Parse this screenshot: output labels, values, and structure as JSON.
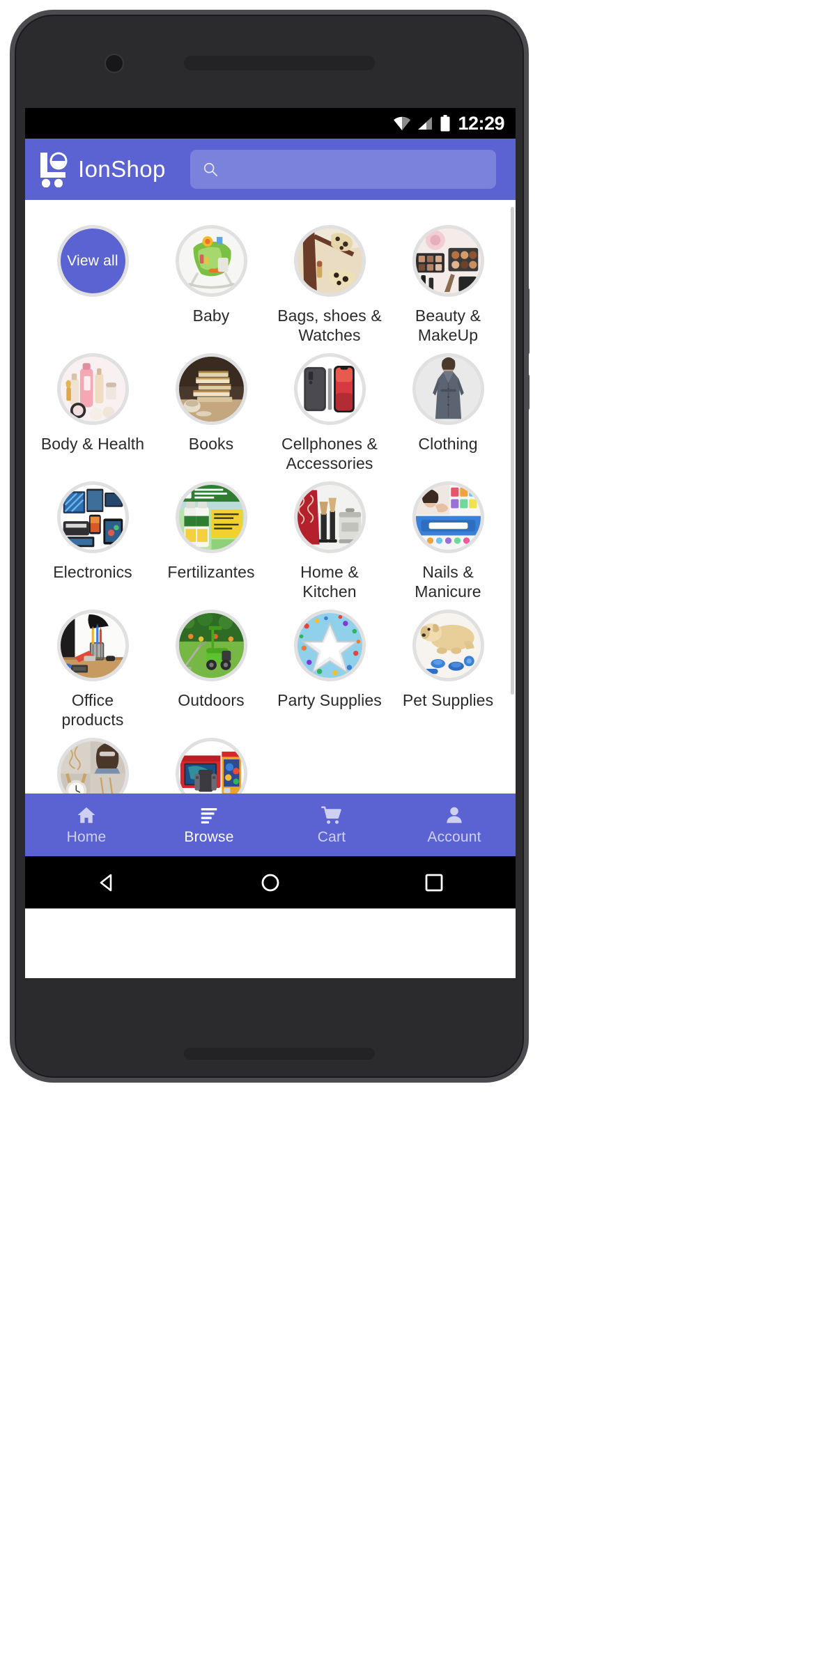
{
  "status_bar": {
    "time": "12:29",
    "icons": [
      "wifi-icon",
      "signal-icon",
      "battery-icon"
    ]
  },
  "header": {
    "brand_name": "IonShop",
    "logo_icon": "shopping-cart-logo-icon",
    "search": {
      "icon": "search-icon",
      "value": "",
      "placeholder": ""
    },
    "accent_color": "#5b63d3"
  },
  "categories": [
    {
      "label": "View all",
      "type": "view-all"
    },
    {
      "label": "Baby",
      "type": "category"
    },
    {
      "label": "Bags, shoes & Watches",
      "type": "category"
    },
    {
      "label": "Beauty & MakeUp",
      "type": "category"
    },
    {
      "label": "Body & Health",
      "type": "category"
    },
    {
      "label": "Books",
      "type": "category"
    },
    {
      "label": "Cellphones & Accessories",
      "type": "category"
    },
    {
      "label": "Clothing",
      "type": "category"
    },
    {
      "label": "Electronics",
      "type": "category"
    },
    {
      "label": "Fertilizantes",
      "type": "category"
    },
    {
      "label": "Home & Kitchen",
      "type": "category"
    },
    {
      "label": "Nails & Manicure",
      "type": "category"
    },
    {
      "label": "Office products",
      "type": "category"
    },
    {
      "label": "Outdoors",
      "type": "category"
    },
    {
      "label": "Party Supplies",
      "type": "category"
    },
    {
      "label": "Pet Supplies",
      "type": "category"
    },
    {
      "label": "",
      "type": "category"
    },
    {
      "label": "",
      "type": "category"
    }
  ],
  "tab_bar": {
    "items": [
      {
        "label": "Home",
        "icon": "home-icon",
        "active": false
      },
      {
        "label": "Browse",
        "icon": "list-icon",
        "active": true
      },
      {
        "label": "Cart",
        "icon": "cart-icon",
        "active": false
      },
      {
        "label": "Account",
        "icon": "person-icon",
        "active": false
      }
    ],
    "background_color": "#5b63d3"
  },
  "android_nav": {
    "buttons": [
      "back-button",
      "home-button",
      "recents-button"
    ]
  }
}
